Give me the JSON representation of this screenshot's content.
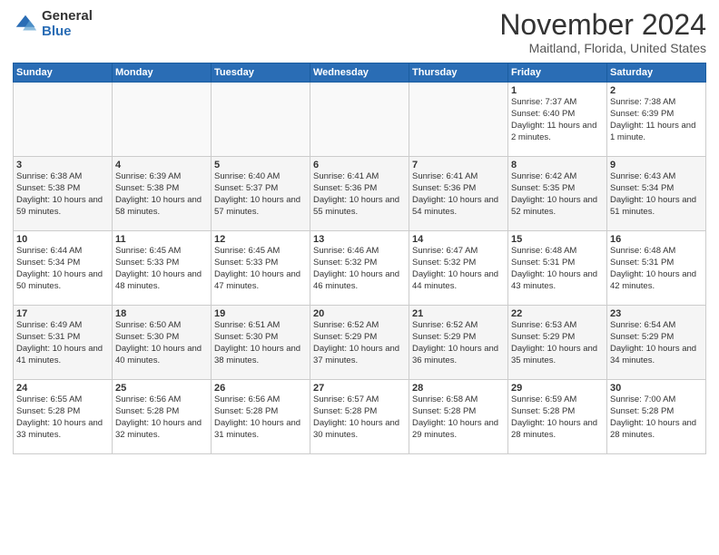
{
  "header": {
    "logo_general": "General",
    "logo_blue": "Blue",
    "month": "November 2024",
    "location": "Maitland, Florida, United States"
  },
  "days_of_week": [
    "Sunday",
    "Monday",
    "Tuesday",
    "Wednesday",
    "Thursday",
    "Friday",
    "Saturday"
  ],
  "weeks": [
    [
      {
        "day": "",
        "info": ""
      },
      {
        "day": "",
        "info": ""
      },
      {
        "day": "",
        "info": ""
      },
      {
        "day": "",
        "info": ""
      },
      {
        "day": "",
        "info": ""
      },
      {
        "day": "1",
        "info": "Sunrise: 7:37 AM\nSunset: 6:40 PM\nDaylight: 11 hours and 2 minutes."
      },
      {
        "day": "2",
        "info": "Sunrise: 7:38 AM\nSunset: 6:39 PM\nDaylight: 11 hours and 1 minute."
      }
    ],
    [
      {
        "day": "3",
        "info": "Sunrise: 6:38 AM\nSunset: 5:38 PM\nDaylight: 10 hours and 59 minutes."
      },
      {
        "day": "4",
        "info": "Sunrise: 6:39 AM\nSunset: 5:38 PM\nDaylight: 10 hours and 58 minutes."
      },
      {
        "day": "5",
        "info": "Sunrise: 6:40 AM\nSunset: 5:37 PM\nDaylight: 10 hours and 57 minutes."
      },
      {
        "day": "6",
        "info": "Sunrise: 6:41 AM\nSunset: 5:36 PM\nDaylight: 10 hours and 55 minutes."
      },
      {
        "day": "7",
        "info": "Sunrise: 6:41 AM\nSunset: 5:36 PM\nDaylight: 10 hours and 54 minutes."
      },
      {
        "day": "8",
        "info": "Sunrise: 6:42 AM\nSunset: 5:35 PM\nDaylight: 10 hours and 52 minutes."
      },
      {
        "day": "9",
        "info": "Sunrise: 6:43 AM\nSunset: 5:34 PM\nDaylight: 10 hours and 51 minutes."
      }
    ],
    [
      {
        "day": "10",
        "info": "Sunrise: 6:44 AM\nSunset: 5:34 PM\nDaylight: 10 hours and 50 minutes."
      },
      {
        "day": "11",
        "info": "Sunrise: 6:45 AM\nSunset: 5:33 PM\nDaylight: 10 hours and 48 minutes."
      },
      {
        "day": "12",
        "info": "Sunrise: 6:45 AM\nSunset: 5:33 PM\nDaylight: 10 hours and 47 minutes."
      },
      {
        "day": "13",
        "info": "Sunrise: 6:46 AM\nSunset: 5:32 PM\nDaylight: 10 hours and 46 minutes."
      },
      {
        "day": "14",
        "info": "Sunrise: 6:47 AM\nSunset: 5:32 PM\nDaylight: 10 hours and 44 minutes."
      },
      {
        "day": "15",
        "info": "Sunrise: 6:48 AM\nSunset: 5:31 PM\nDaylight: 10 hours and 43 minutes."
      },
      {
        "day": "16",
        "info": "Sunrise: 6:48 AM\nSunset: 5:31 PM\nDaylight: 10 hours and 42 minutes."
      }
    ],
    [
      {
        "day": "17",
        "info": "Sunrise: 6:49 AM\nSunset: 5:31 PM\nDaylight: 10 hours and 41 minutes."
      },
      {
        "day": "18",
        "info": "Sunrise: 6:50 AM\nSunset: 5:30 PM\nDaylight: 10 hours and 40 minutes."
      },
      {
        "day": "19",
        "info": "Sunrise: 6:51 AM\nSunset: 5:30 PM\nDaylight: 10 hours and 38 minutes."
      },
      {
        "day": "20",
        "info": "Sunrise: 6:52 AM\nSunset: 5:29 PM\nDaylight: 10 hours and 37 minutes."
      },
      {
        "day": "21",
        "info": "Sunrise: 6:52 AM\nSunset: 5:29 PM\nDaylight: 10 hours and 36 minutes."
      },
      {
        "day": "22",
        "info": "Sunrise: 6:53 AM\nSunset: 5:29 PM\nDaylight: 10 hours and 35 minutes."
      },
      {
        "day": "23",
        "info": "Sunrise: 6:54 AM\nSunset: 5:29 PM\nDaylight: 10 hours and 34 minutes."
      }
    ],
    [
      {
        "day": "24",
        "info": "Sunrise: 6:55 AM\nSunset: 5:28 PM\nDaylight: 10 hours and 33 minutes."
      },
      {
        "day": "25",
        "info": "Sunrise: 6:56 AM\nSunset: 5:28 PM\nDaylight: 10 hours and 32 minutes."
      },
      {
        "day": "26",
        "info": "Sunrise: 6:56 AM\nSunset: 5:28 PM\nDaylight: 10 hours and 31 minutes."
      },
      {
        "day": "27",
        "info": "Sunrise: 6:57 AM\nSunset: 5:28 PM\nDaylight: 10 hours and 30 minutes."
      },
      {
        "day": "28",
        "info": "Sunrise: 6:58 AM\nSunset: 5:28 PM\nDaylight: 10 hours and 29 minutes."
      },
      {
        "day": "29",
        "info": "Sunrise: 6:59 AM\nSunset: 5:28 PM\nDaylight: 10 hours and 28 minutes."
      },
      {
        "day": "30",
        "info": "Sunrise: 7:00 AM\nSunset: 5:28 PM\nDaylight: 10 hours and 28 minutes."
      }
    ]
  ]
}
